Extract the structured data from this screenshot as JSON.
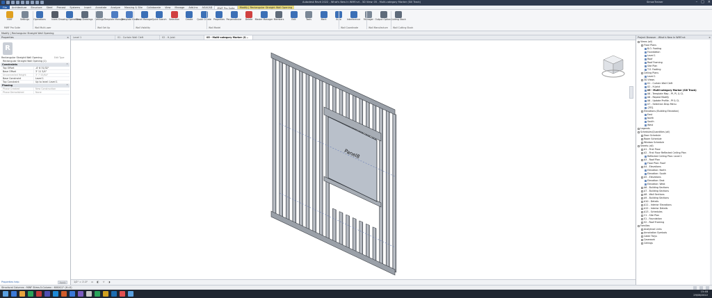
{
  "titlebar": {
    "title": "Autodesk Revit 2022 - What's New In WMF.rvt - 3D View: 05 - Multi-category Marker (Sill Track)",
    "user": "SimonTrainer"
  },
  "menu_tabs": [
    "File",
    "Architecture",
    "Structure",
    "Steel",
    "Precast",
    "Systems",
    "Insert",
    "Annotate",
    "Analyze",
    "Massing & Site",
    "Collaborate",
    "View",
    "Manage",
    "Add-Ins",
    "AGACAD",
    "MWF Pro Suite",
    "Modify | Rectangular Straight Wall Opening"
  ],
  "ribbon": {
    "buttons": [
      {
        "label": "MWF",
        "color": "#e0a020"
      },
      {
        "label": "Settings",
        "color": "#7a8796"
      },
      {
        "label": "Operations",
        "color": "#3b6fb6"
      },
      {
        "label": "Icons",
        "color": "#555c66"
      },
      {
        "label": "Drawing Operations",
        "color": "#3b6fb6"
      },
      {
        "label": "Shop Drawings",
        "color": "#5f6b7a"
      },
      {
        "label": "Settings",
        "color": "#7a8796"
      },
      {
        "label": "Template Manager",
        "color": "#4d7cc2"
      },
      {
        "label": "Template View",
        "color": "#4d7cc2"
      },
      {
        "label": "Panel Manager",
        "color": "#3b6fb6"
      },
      {
        "label": "Quick Search",
        "color": "#3b6fb6"
      },
      {
        "label": "Selection",
        "color": "#d04040"
      },
      {
        "label": "Create",
        "color": "#3b6fb6"
      },
      {
        "label": "Quick Create",
        "color": "#3b6fb6"
      },
      {
        "label": "Properties",
        "color": "#3b6fb6"
      },
      {
        "label": "Perpendicular",
        "color": "#3b6fb6"
      },
      {
        "label": "Delete",
        "color": "#d04040"
      },
      {
        "label": "Master Manager",
        "color": "#3b6fb6"
      },
      {
        "label": "Members",
        "color": "#5f6b7a"
      },
      {
        "label": "Edit",
        "color": "#3b6fb6"
      },
      {
        "label": "Tools",
        "color": "#7a8796"
      },
      {
        "label": "Mark",
        "color": "#3b6fb6"
      },
      {
        "label": "Auto",
        "color": "#3b6fb6"
      },
      {
        "label": "Interference",
        "color": "#3b6fb6"
      },
      {
        "label": "Manager",
        "color": "#7a8796"
      },
      {
        "label": "Output Options",
        "color": "#5f6b7a"
      },
      {
        "label": "Cutting Stock",
        "color": "#5f6b7a"
      }
    ],
    "panels": [
      "MWF Pro Suite",
      "Wall Multi-user",
      "Wall Set Up",
      "Wall Visibility",
      "Wall Model",
      "Wall Coordinate",
      "Wall Manufacture",
      "Wall Cutting Stock"
    ]
  },
  "options_bar": "Modify | Rectangular Straight Wall Opening",
  "properties": {
    "header": "Properties",
    "family_type": "Rectangular Straight Wall Opening",
    "edit_type": "Edit Type",
    "instance": "Rectangular Straight Wall Opening (1)",
    "sections": [
      {
        "title": "Constraints",
        "rows": [
          {
            "k": "Top Offset",
            "v": "-0' 6 31/32\"",
            "grey": false
          },
          {
            "k": "Base Offset",
            "v": "3' 11 3/4\"",
            "grey": false
          },
          {
            "k": "Unconnected Height",
            "v": "3' 7 53/64\"",
            "grey": true
          },
          {
            "k": "Base Constraint",
            "v": "Level 1",
            "grey": false
          },
          {
            "k": "Top Constraint",
            "v": "Up to level: Level 1",
            "grey": false
          }
        ]
      },
      {
        "title": "Phasing",
        "rows": [
          {
            "k": "Phase Created",
            "v": "New Construction",
            "grey": true
          },
          {
            "k": "Phase Demolished",
            "v": "None",
            "grey": true
          }
        ]
      }
    ],
    "help_link": "Properties help",
    "apply": "Apply"
  },
  "view_tabs": [
    "Level 1",
    "01 - Curtain Wall Cleft",
    "02 - H-Joist",
    "05 - Multi-category Marker (S..."
  ],
  "panel_label": "Panel8",
  "view_control_bar": "1/2\" = 1'-0\"",
  "project_browser": {
    "header": "Project Browser - What's New In WMF.rvt",
    "nodes": [
      {
        "label": "Views (all)",
        "depth": 0,
        "sel": false
      },
      {
        "label": "Floor Plans",
        "depth": 1,
        "sel": false
      },
      {
        "label": "B.O. Footing",
        "depth": 2,
        "sel": false
      },
      {
        "label": "Foundation",
        "depth": 2,
        "sel": false
      },
      {
        "label": "Level 1",
        "depth": 2,
        "sel": false
      },
      {
        "label": "Roof",
        "depth": 2,
        "sel": false
      },
      {
        "label": "Roof Framing",
        "depth": 2,
        "sel": false
      },
      {
        "label": "Site Plan",
        "depth": 2,
        "sel": false
      },
      {
        "label": "T.O. Footing",
        "depth": 2,
        "sel": false
      },
      {
        "label": "Ceiling Plans",
        "depth": 1,
        "sel": false
      },
      {
        "label": "Level 1",
        "depth": 2,
        "sel": false
      },
      {
        "label": "3D Views",
        "depth": 1,
        "sel": false
      },
      {
        "label": "01 - Curtain Wall Cleft",
        "depth": 2,
        "sel": false
      },
      {
        "label": "02 - H-Joist",
        "depth": 2,
        "sel": false
      },
      {
        "label": "05 - Multi-category Marker (Sill Track)",
        "depth": 2,
        "sel": true
      },
      {
        "label": "06 - Template Map - Pf, Pl, & CL",
        "depth": 2,
        "sel": false
      },
      {
        "label": "06 - Repeat Modify",
        "depth": 2,
        "sel": false
      },
      {
        "label": "06 - Update Profile - Pf & CL",
        "depth": 2,
        "sel": false
      },
      {
        "label": "07 - Selection Drop Menu",
        "depth": 2,
        "sel": false
      },
      {
        "label": "{3D}",
        "depth": 2,
        "sel": false
      },
      {
        "label": "Elevations (Building Elevation)",
        "depth": 1,
        "sel": false
      },
      {
        "label": "East",
        "depth": 2,
        "sel": false
      },
      {
        "label": "North",
        "depth": 2,
        "sel": false
      },
      {
        "label": "South",
        "depth": 2,
        "sel": false
      },
      {
        "label": "West",
        "depth": 2,
        "sel": false
      },
      {
        "label": "Legends",
        "depth": 0,
        "sel": false
      },
      {
        "label": "Schedules/Quantities (all)",
        "depth": 0,
        "sel": false
      },
      {
        "label": "Door Schedule",
        "depth": 1,
        "sel": false
      },
      {
        "label": "Room Schedule",
        "depth": 1,
        "sel": false
      },
      {
        "label": "Window Schedule",
        "depth": 1,
        "sel": false
      },
      {
        "label": "Sheets (all)",
        "depth": 0,
        "sel": false
      },
      {
        "label": "A1 - First Floor",
        "depth": 1,
        "sel": false
      },
      {
        "label": "A2 - First Floor Reflected Ceiling Plan",
        "depth": 1,
        "sel": false
      },
      {
        "label": "Reflected Ceiling Plan: Level 1",
        "depth": 2,
        "sel": false
      },
      {
        "label": "A3 - Roof Plan",
        "depth": 1,
        "sel": false
      },
      {
        "label": "Floor Plan: Roof",
        "depth": 2,
        "sel": false
      },
      {
        "label": "A4 - Elevations",
        "depth": 1,
        "sel": false
      },
      {
        "label": "Elevation: North",
        "depth": 2,
        "sel": false
      },
      {
        "label": "Elevation: South",
        "depth": 2,
        "sel": false
      },
      {
        "label": "A5 - Elevations",
        "depth": 1,
        "sel": false
      },
      {
        "label": "Elevation: East",
        "depth": 2,
        "sel": false
      },
      {
        "label": "Elevation: West",
        "depth": 2,
        "sel": false
      },
      {
        "label": "A6 - Building Sections",
        "depth": 1,
        "sel": false
      },
      {
        "label": "A7 - Building Sections",
        "depth": 1,
        "sel": false
      },
      {
        "label": "A8 - Wall Sections",
        "depth": 1,
        "sel": false
      },
      {
        "label": "A9 - Building Sections",
        "depth": 1,
        "sel": false
      },
      {
        "label": "A10 - Details",
        "depth": 1,
        "sel": false
      },
      {
        "label": "A11 - Interior Elevations",
        "depth": 1,
        "sel": false
      },
      {
        "label": "A12 - Interior Details",
        "depth": 1,
        "sel": false
      },
      {
        "label": "A13 - Schedules",
        "depth": 1,
        "sel": false
      },
      {
        "label": "C1 - Site Plan",
        "depth": 1,
        "sel": false
      },
      {
        "label": "S1 - Foundation",
        "depth": 1,
        "sel": false
      },
      {
        "label": "S2 - Roof Framing",
        "depth": 1,
        "sel": false
      },
      {
        "label": "Families",
        "depth": 0,
        "sel": false
      },
      {
        "label": "Analytical Links",
        "depth": 1,
        "sel": false
      },
      {
        "label": "Annotation Symbols",
        "depth": 1,
        "sel": false
      },
      {
        "label": "Cable Trays",
        "depth": 1,
        "sel": false
      },
      {
        "label": "Casework",
        "depth": 1,
        "sel": false
      },
      {
        "label": "Ceilings",
        "depth": 1,
        "sel": false
      }
    ]
  },
  "status_bar": "Structural Columns : MWF Stims-5-Column : 600X12\" (H=0)",
  "taskbar": {
    "time": "15:48",
    "date": "29/06/2022",
    "app_colors": [
      "#3a78d6",
      "#e8a33d",
      "#2aa45a",
      "#c43b3b",
      "#4f4fb3",
      "#1f8ad6",
      "#d05c2a",
      "#3a78d6",
      "#7b5cc0",
      "#c8c8c8",
      "#2aa45a",
      "#d0a020",
      "#1d6db0",
      "#e05050",
      "#5aa0e0"
    ]
  }
}
